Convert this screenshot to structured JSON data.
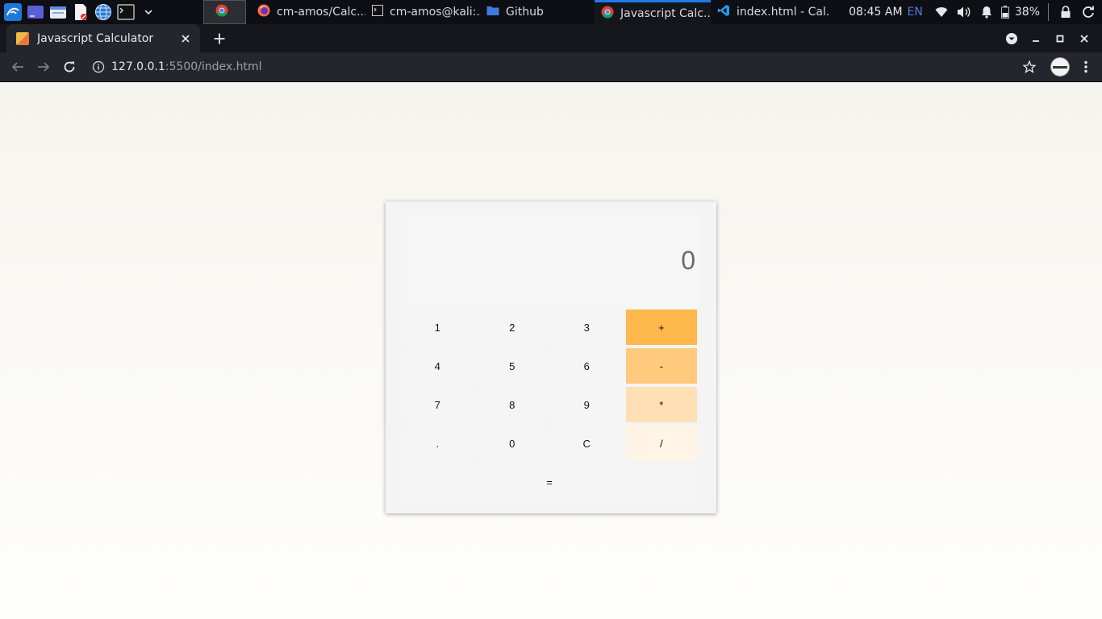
{
  "taskbar": {
    "launchers": [
      "kali-menu-icon",
      "workspace-icon",
      "file-manager-icon",
      "text-editor-icon",
      "web-browser-icon",
      "terminal-icon",
      "chevron-down-icon"
    ],
    "windows": [
      {
        "label": "",
        "icon": "chrome-icon"
      },
      {
        "label": "cm-amos/Calc...",
        "icon": "firefox-icon"
      },
      {
        "label": "cm-amos@kali:...",
        "icon": "terminal-icon"
      },
      {
        "label": "Github",
        "icon": "folder-icon"
      },
      {
        "label": "Javascript Calc...",
        "icon": "chrome-icon"
      },
      {
        "label": "index.html - Cal...",
        "icon": "vscode-icon"
      }
    ],
    "clock": "08:45 AM",
    "language": "EN",
    "battery": "38%"
  },
  "browser": {
    "tab_title": "Javascript Calculator",
    "url_host": "127.0.0.1",
    "url_path": ":5500/index.html"
  },
  "calculator": {
    "display": "0",
    "keys": [
      {
        "label": "1",
        "style": "num"
      },
      {
        "label": "2",
        "style": "num"
      },
      {
        "label": "3",
        "style": "num"
      },
      {
        "label": "+",
        "style": "op1"
      },
      {
        "label": "4",
        "style": "num"
      },
      {
        "label": "5",
        "style": "num"
      },
      {
        "label": "6",
        "style": "num"
      },
      {
        "label": "-",
        "style": "op2"
      },
      {
        "label": "7",
        "style": "num"
      },
      {
        "label": "8",
        "style": "num"
      },
      {
        "label": "9",
        "style": "num"
      },
      {
        "label": "*",
        "style": "op3"
      },
      {
        "label": ".",
        "style": "num"
      },
      {
        "label": "0",
        "style": "num"
      },
      {
        "label": "C",
        "style": "num"
      },
      {
        "label": "/",
        "style": "op4"
      },
      {
        "label": "=",
        "style": "equals"
      }
    ]
  },
  "colors": {
    "op_plus": "#ffb84b",
    "op_minus": "#ffc97e",
    "op_multiply": "#ffe0b5",
    "op_divide": "#fff4e6",
    "key_bg": "#f5f5f5",
    "accent_blue": "#1f7aea"
  }
}
